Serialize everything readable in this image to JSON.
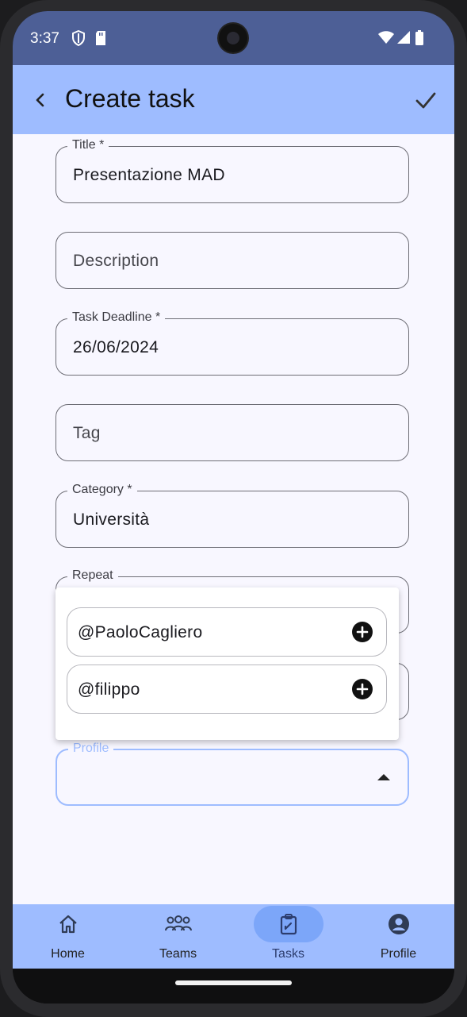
{
  "status_bar": {
    "time": "3:37"
  },
  "app_bar": {
    "title": "Create task"
  },
  "form": {
    "title": {
      "label": "Title *",
      "value": "Presentazione MAD"
    },
    "description": {
      "placeholder": "Description"
    },
    "deadline": {
      "label": "Task Deadline *",
      "value": "26/06/2024"
    },
    "tag": {
      "placeholder": "Tag"
    },
    "category": {
      "label": "Category *",
      "value": "Università"
    },
    "repeat": {
      "label": "Repeat"
    },
    "profile": {
      "label": "Profile"
    }
  },
  "member_suggestions": [
    {
      "name": "@PaoloCagliero"
    },
    {
      "name": "@filippo"
    }
  ],
  "bottom_nav": {
    "items": [
      {
        "label": "Home",
        "icon": "home-icon"
      },
      {
        "label": "Teams",
        "icon": "teams-icon"
      },
      {
        "label": "Tasks",
        "icon": "tasks-icon",
        "active": true
      },
      {
        "label": "Profile",
        "icon": "profile-icon"
      }
    ]
  },
  "colors": {
    "app_bar": "#9ebcff",
    "status_bar": "#4d5f96",
    "active_nav_pill": "#7ca6f9",
    "background": "#f8f7ff"
  }
}
